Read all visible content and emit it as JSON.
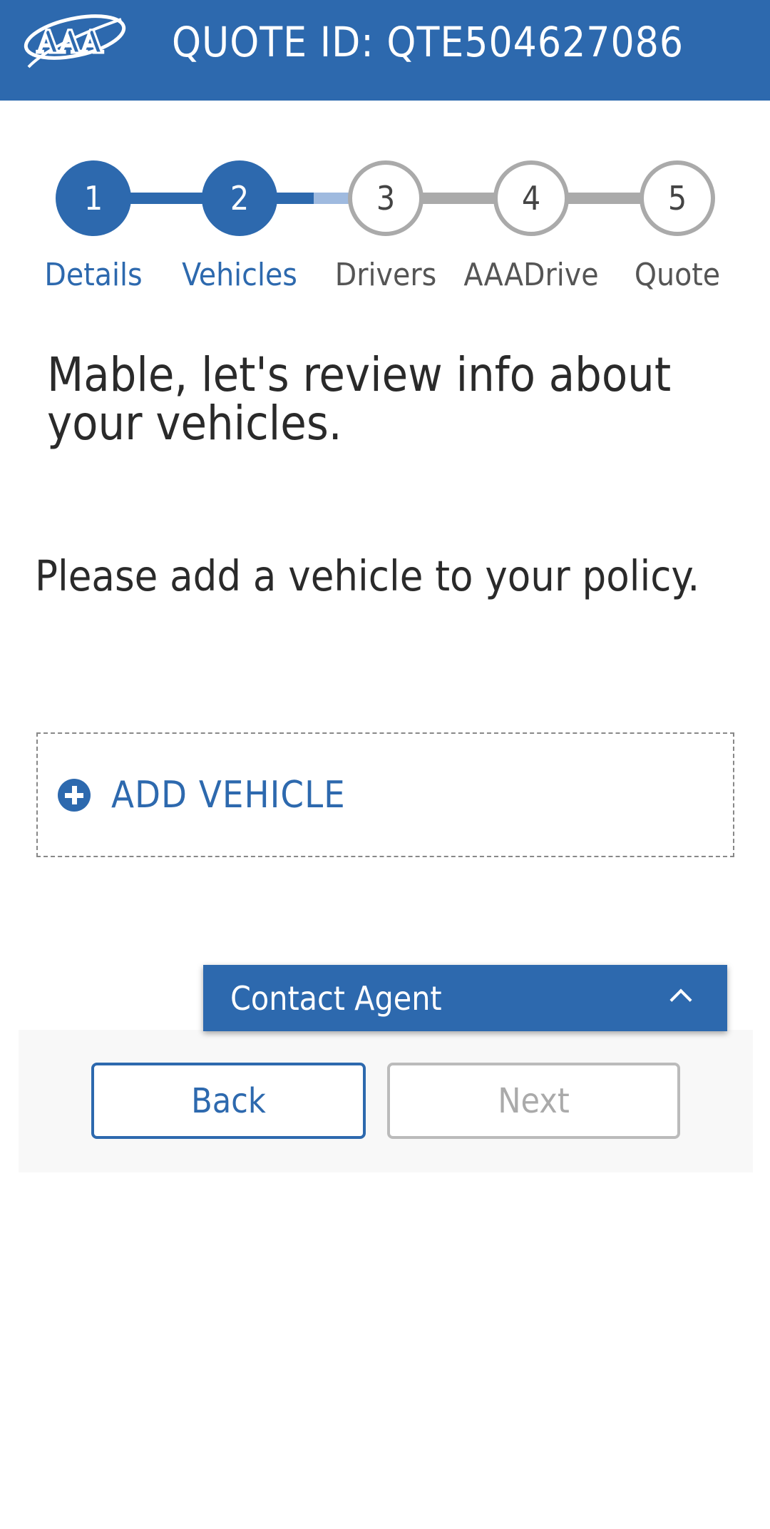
{
  "header": {
    "logo_text": "AAA",
    "quote_id": "QUOTE ID: QTE504627086",
    "brand_color": "#2d69ae"
  },
  "stepper": {
    "current_step": 2,
    "steps": [
      {
        "number": "1",
        "label": "Details",
        "state": "complete"
      },
      {
        "number": "2",
        "label": "Vehicles",
        "state": "current"
      },
      {
        "number": "3",
        "label": "Drivers",
        "state": "upcoming"
      },
      {
        "number": "4",
        "label": "AAADrive",
        "state": "upcoming"
      },
      {
        "number": "5",
        "label": "Quote",
        "state": "upcoming"
      }
    ]
  },
  "main": {
    "headline": "Mable, let's review info about your vehicles.",
    "prompt": "Please add a vehicle to your policy.",
    "add_vehicle_label": "ADD VEHICLE"
  },
  "contact_agent": {
    "label": "Contact Agent",
    "icon": "chevron-up-icon"
  },
  "navigation": {
    "back_label": "Back",
    "next_label": "Next",
    "next_disabled": true
  }
}
